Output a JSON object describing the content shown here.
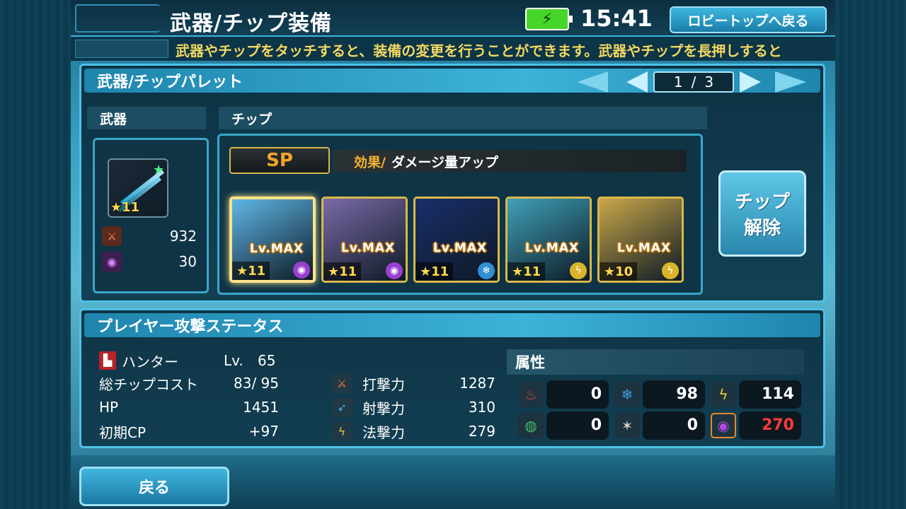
{
  "header": {
    "title": "武器/チップ装備",
    "time": "15:41",
    "lobby_button": "ロビートップへ戻る",
    "battery_icon": "battery-charging-icon"
  },
  "ticker": {
    "text": "武器やチップをタッチすると、装備の変更を行うことができます。武器やチップを長押しすると"
  },
  "palette": {
    "title": "武器/チップパレット",
    "page_current": "1",
    "page_sep": "/",
    "page_total": "3",
    "weapon_label": "武器",
    "chip_label": "チップ",
    "weapon": {
      "rarity": "★11",
      "stats": [
        {
          "icon": "strike-icon",
          "value": "932",
          "color": "#d85a2a"
        },
        {
          "icon": "dark-element-icon",
          "value": "30",
          "color": "#b04adb"
        }
      ]
    },
    "sp_label": "SP",
    "effect_key": "効果/",
    "effect_value": "ダメージ量アップ",
    "chips": [
      {
        "level": "Lv.MAX",
        "rarity": "★11",
        "element": "dark",
        "element_color": "#9a3fd1",
        "art_color": "#5fb7e8"
      },
      {
        "level": "Lv.MAX",
        "rarity": "★11",
        "element": "dark",
        "element_color": "#9a3fd1",
        "art_color": "#7a6aa8"
      },
      {
        "level": "Lv.MAX",
        "rarity": "★11",
        "element": "ice",
        "element_color": "#2f8fd0",
        "art_color": "#1a2e6a"
      },
      {
        "level": "Lv.MAX",
        "rarity": "★11",
        "element": "lightning",
        "element_color": "#d9b42a",
        "art_color": "#3fa0b8"
      },
      {
        "level": "Lv.MAX",
        "rarity": "★10",
        "element": "lightning",
        "element_color": "#d9b42a",
        "art_color": "#c9a74a"
      }
    ],
    "release_button_line1": "チップ",
    "release_button_line2": "解除"
  },
  "status": {
    "title": "プレイヤー攻撃ステータス",
    "class_name": "ハンター",
    "level_label": "Lv.",
    "level": "65",
    "rows": [
      {
        "label": "総チップコスト",
        "value": "83/ 95"
      },
      {
        "label": "HP",
        "value": "1451"
      },
      {
        "label": "初期CP",
        "value": "+97"
      }
    ],
    "attacks": [
      {
        "icon": "strike-icon",
        "label": "打撃力",
        "value": "1287",
        "color": "#d85a2a"
      },
      {
        "icon": "range-icon",
        "label": "射撃力",
        "value": "310",
        "color": "#3d9ee0"
      },
      {
        "icon": "tech-icon",
        "label": "法撃力",
        "value": "279",
        "color": "#d9b42a"
      }
    ],
    "attribute_title": "属性",
    "attributes": [
      {
        "icon": "fire-icon",
        "value": "0",
        "color": "#e0463a",
        "highlight": false
      },
      {
        "icon": "ice-icon",
        "value": "98",
        "color": "#3da0e0",
        "highlight": false
      },
      {
        "icon": "lightning-icon",
        "value": "114",
        "color": "#e4d22a",
        "highlight": false
      },
      {
        "icon": "wind-icon",
        "value": "0",
        "color": "#3fbf6a",
        "highlight": false
      },
      {
        "icon": "light-icon",
        "value": "0",
        "color": "#d8d0c0",
        "highlight": false
      },
      {
        "icon": "dark-icon",
        "value": "270",
        "color": "#b04adb",
        "highlight": true
      }
    ]
  },
  "back_button": "戻る"
}
